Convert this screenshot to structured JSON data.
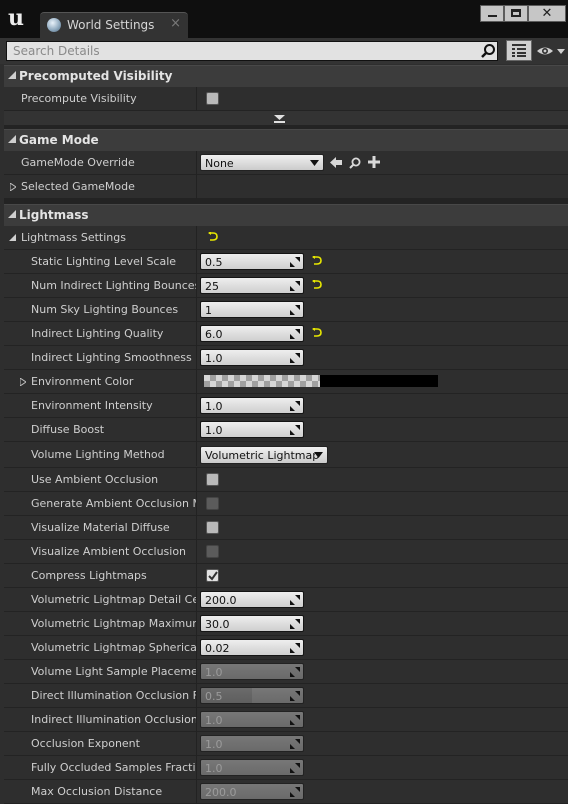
{
  "window": {
    "tab_title": "World Settings",
    "tab_close": "×"
  },
  "search": {
    "placeholder": "Search Details"
  },
  "precomputed_visibility": {
    "header": "Precomputed Visibility",
    "precompute_visibility_label": "Precompute Visibility",
    "precompute_visibility_checked": false
  },
  "game_mode": {
    "header": "Game Mode",
    "override_label": "GameMode Override",
    "override_value": "None",
    "selected_label": "Selected GameMode"
  },
  "lightmass": {
    "header": "Lightmass",
    "settings_label": "Lightmass Settings",
    "props": {
      "static_lighting_level_scale": {
        "label": "Static Lighting Level Scale",
        "value": "0.5"
      },
      "num_indirect_bounces": {
        "label": "Num Indirect Lighting Bounces",
        "value": "25"
      },
      "num_sky_bounces": {
        "label": "Num Sky Lighting Bounces",
        "value": "1"
      },
      "indirect_quality": {
        "label": "Indirect Lighting Quality",
        "value": "6.0"
      },
      "indirect_smoothness": {
        "label": "Indirect Lighting Smoothness",
        "value": "1.0"
      },
      "environment_color": {
        "label": "Environment Color"
      },
      "environment_intensity": {
        "label": "Environment Intensity",
        "value": "1.0"
      },
      "diffuse_boost": {
        "label": "Diffuse Boost",
        "value": "1.0"
      },
      "volume_lighting_method": {
        "label": "Volume Lighting Method",
        "value": "Volumetric Lightmap"
      },
      "use_ambient_occlusion": {
        "label": "Use Ambient Occlusion",
        "checked": false
      },
      "generate_ao_material_mask": {
        "label": "Generate Ambient Occlusion Mat",
        "checked": false
      },
      "visualize_material_diffuse": {
        "label": "Visualize Material Diffuse",
        "checked": false
      },
      "visualize_ambient_occlusion": {
        "label": "Visualize Ambient Occlusion",
        "checked": false
      },
      "compress_lightmaps": {
        "label": "Compress Lightmaps",
        "checked": true
      },
      "vlm_detail_cell_size": {
        "label": "Volumetric Lightmap Detail Cell S",
        "value": "200.0"
      },
      "vlm_maximum_brick": {
        "label": "Volumetric Lightmap Maximum B",
        "value": "30.0"
      },
      "vlm_spherical_harmonic": {
        "label": "Volumetric Lightmap Spherical H",
        "value": "0.02"
      },
      "volume_light_sample_placement": {
        "label": "Volume Light Sample Placement",
        "value": "1.0"
      },
      "direct_illum_occlusion_fraction": {
        "label": "Direct Illumination Occlusion Fra",
        "value": "0.5"
      },
      "indirect_illum_occlusion_fraction": {
        "label": "Indirect Illumination Occlusion Fr",
        "value": "1.0"
      },
      "occlusion_exponent": {
        "label": "Occlusion Exponent",
        "value": "1.0"
      },
      "fully_occluded_samples_fraction": {
        "label": "Fully Occluded Samples Fraction",
        "value": "1.0"
      },
      "max_occlusion_distance": {
        "label": "Max Occlusion Distance",
        "value": "200.0"
      }
    }
  },
  "colors": {
    "reset_arrow": "#e8e800",
    "panel_bg": "#2e2e2e",
    "category_bg": "#3c3c3c"
  },
  "icons": [
    "unreal-logo-icon",
    "globe-icon",
    "search-icon",
    "grid-view-icon",
    "eye-icon",
    "browse-arrow-icon",
    "find-icon",
    "add-icon",
    "reset-to-default-icon",
    "spin-arrow-icon",
    "triangle-expand-icon",
    "triangle-collapsed-icon",
    "dropdown-arrow-icon",
    "checkmark-icon"
  ]
}
